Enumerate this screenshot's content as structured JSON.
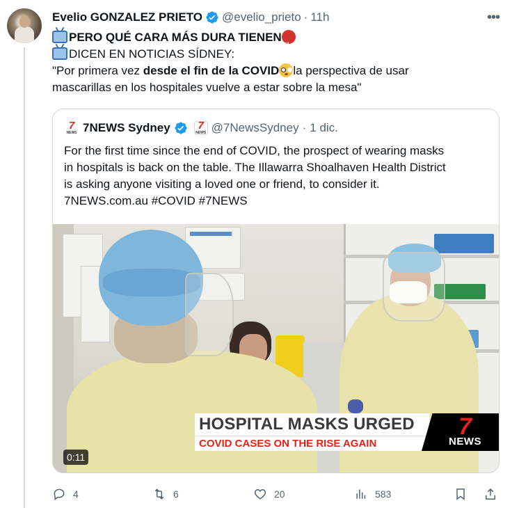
{
  "tweet": {
    "author": {
      "name": "Evelio GONZALEZ PRIETO",
      "handle": "@evelio_prieto",
      "separator": "·",
      "time": "11h"
    },
    "lines": {
      "l1": "PERO QUÉ CARA MÁS DURA TIENEN",
      "l2": "DICEN EN NOTICIAS SÍDNEY:",
      "l3_a": "\"Por primera vez ",
      "l3_b": "desde el fin de la COVID",
      "l3_c": "la perspectiva de usar",
      "l4": "mascarillas en los hospitales vuelve a estar sobre la mesa\""
    },
    "emoji": [
      "tv-icon",
      "angry-cursing-face-icon",
      "flushed-face-icon"
    ]
  },
  "quote": {
    "name": "7NEWS Sydney",
    "handle": "@7NewsSydney",
    "separator": "·",
    "date": "1 dic.",
    "logo": {
      "seven": "7",
      "news": "NEWS"
    },
    "lines": [
      "For the first time since the end of COVID, the prospect of wearing masks",
      "in hospitals is back on the table. The Illawarra Shoalhaven Health District",
      "is asking anyone visiting a loved one or friend, to consider it.",
      "7NEWS.com.au #COVID #7NEWS"
    ],
    "video": {
      "headline": "HOSPITAL MASKS URGED",
      "subheadline": "COVID CASES ON THE RISE AGAIN",
      "logo_seven": "7",
      "logo_news": "NEWS",
      "duration": "0:11"
    }
  },
  "actions": {
    "replies": "4",
    "retweets": "6",
    "likes": "20",
    "views": "583"
  },
  "colors": {
    "text": "#0f1419",
    "muted": "#536471",
    "verified": "#1d9bf0",
    "brand_red": "#e2231a",
    "border": "#cfd9de"
  }
}
